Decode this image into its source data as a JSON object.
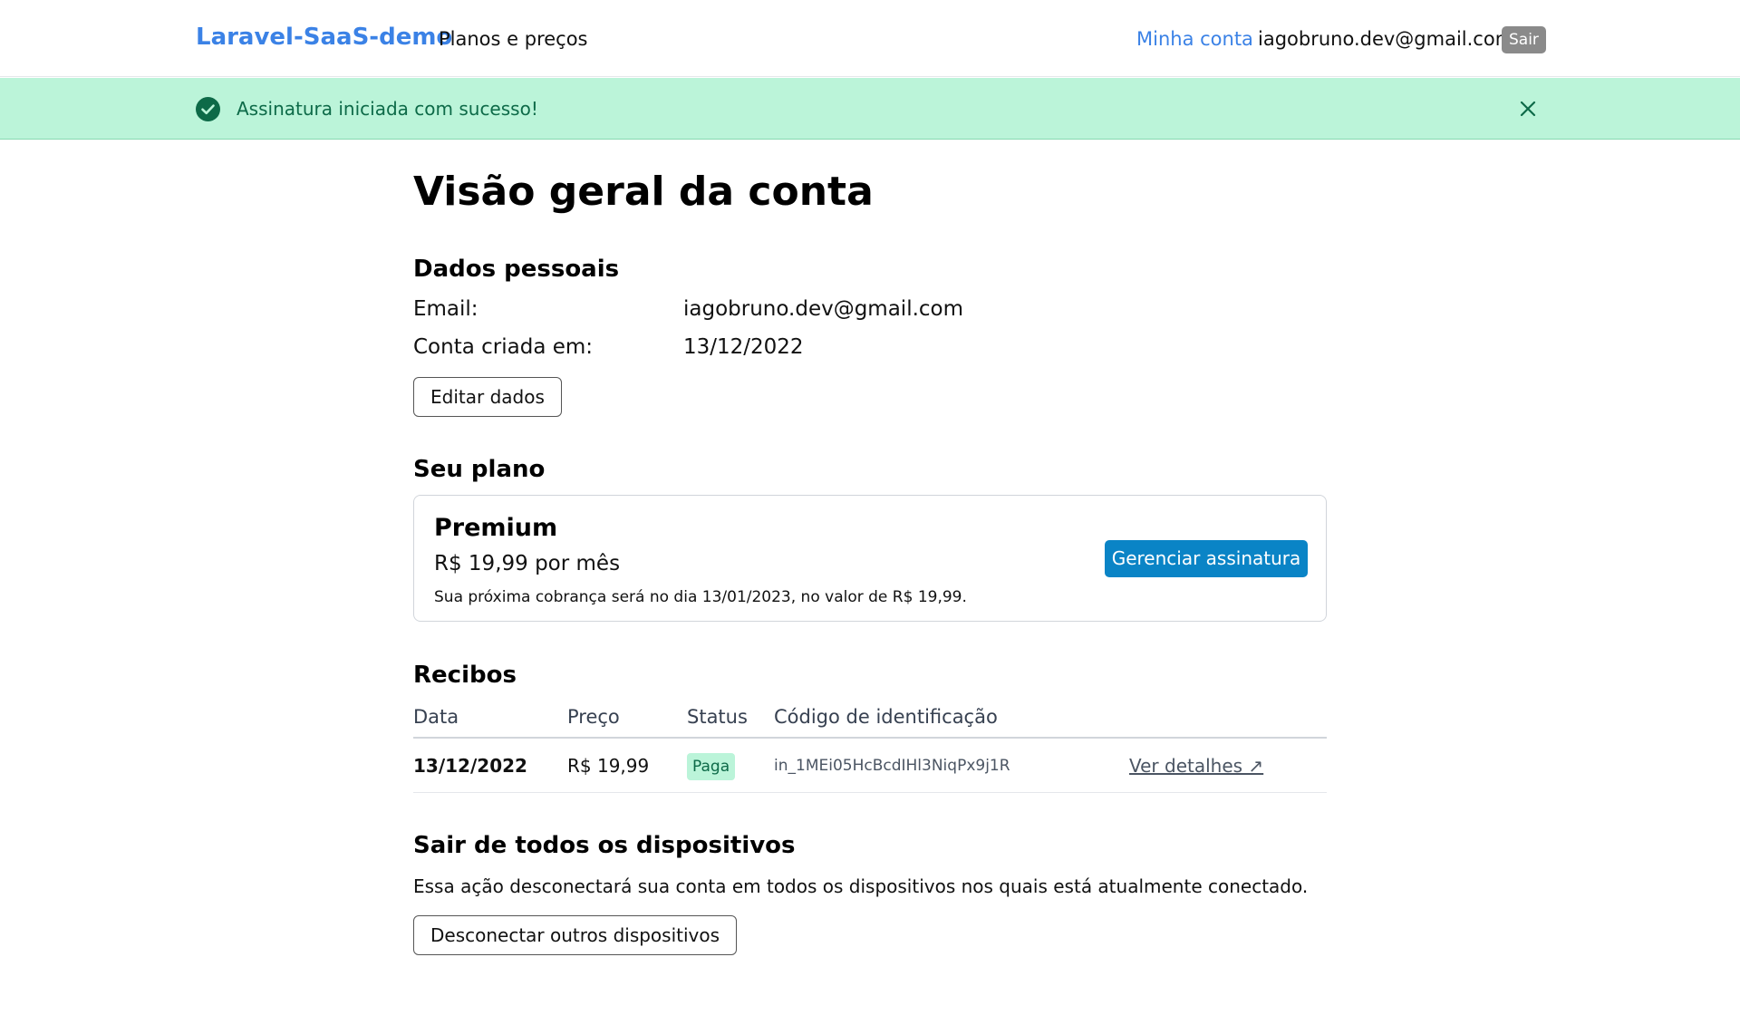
{
  "nav": {
    "brand": "Laravel-SaaS-demo",
    "pricing_link": "Planos e preços",
    "account_link": "Minha conta",
    "user_email": "iagobruno.dev@gmail.com",
    "logout_button": "Sair"
  },
  "alert": {
    "message": "Assinatura iniciada com sucesso!",
    "icon": "check-circle-icon",
    "close_icon": "close-icon"
  },
  "page": {
    "title": "Visão geral da conta"
  },
  "personal": {
    "section_title": "Dados pessoais",
    "email_label": "Email:",
    "email_value": "iagobruno.dev@gmail.com",
    "created_label": "Conta criada em:",
    "created_value": "13/12/2022",
    "edit_button": "Editar dados"
  },
  "plan": {
    "section_title": "Seu plano",
    "name": "Premium",
    "price": "R$ 19,99 por mês",
    "next_charge": "Sua próxima cobrança será no dia 13/01/2023, no valor de R$ 19,99.",
    "manage_button": "Gerenciar assinatura"
  },
  "receipts": {
    "section_title": "Recibos",
    "columns": [
      "Data",
      "Preço",
      "Status",
      "Código de identificação"
    ],
    "rows": [
      {
        "date": "13/12/2022",
        "price": "R$ 19,99",
        "status": "Paga",
        "code": "in_1MEi05HcBcdIHl3NiqPx9j1R",
        "link": "Ver detalhes ↗"
      }
    ]
  },
  "logout_all": {
    "section_title": "Sair de todos os dispositivos",
    "description": "Essa ação desconectará sua conta em todos os dispositivos nos quais está atualmente conectado.",
    "button": "Desconectar outros dispositivos"
  },
  "colors": {
    "brand": "#3b82e6",
    "success_bg": "#bbf4d9",
    "success_text": "#0d6a48",
    "primary_button": "#0a84c6"
  }
}
